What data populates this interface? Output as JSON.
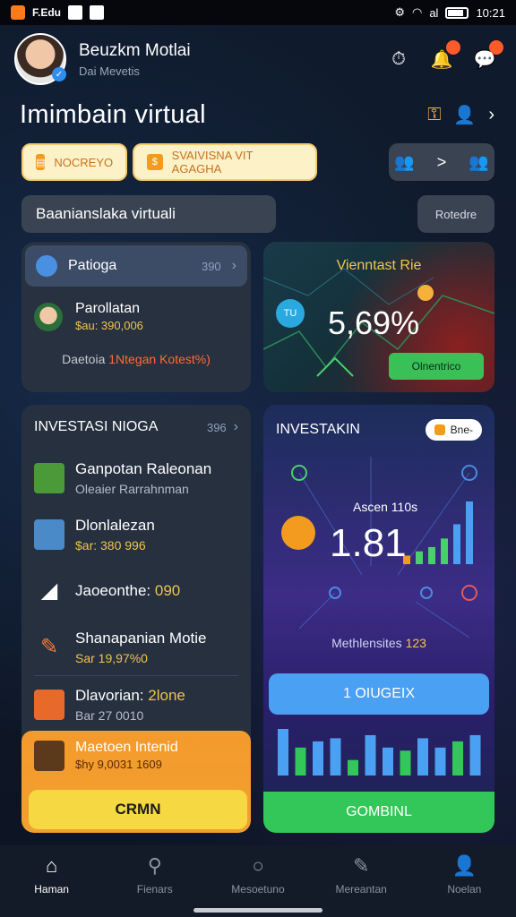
{
  "status_bar": {
    "left_text": "F.Edu",
    "time": "10:21",
    "signal_text": "al"
  },
  "header": {
    "user_name": "Beuzkm Motlai",
    "user_subtitle": "Dai Mevetis"
  },
  "title": {
    "text": "Imimbain virtual"
  },
  "chips": {
    "chip1": "NOCREYO",
    "chip2": "SVAIVISNA VIT AGAGHA",
    "chip3_icons": ">"
  },
  "search": {
    "text": "Baanianslaka virtuali",
    "button": "Rotedre"
  },
  "card_lt": {
    "row_label": "Patioga",
    "row_amount": "390",
    "item_name": "Parollatan",
    "item_value": "$au: 390,006",
    "foot_text": "Daetoia ",
    "foot_highlight": "1Ntegan Kotest%)"
  },
  "card_rt": {
    "title": "Vienntast Rie",
    "badge": "TU",
    "pct": "5,69%",
    "button": "Olnentrico"
  },
  "card_lb": {
    "title": "INVESTASI NIOGA",
    "amount": "396",
    "items": [
      {
        "name": "Ganpotan Raleonan",
        "sub": "Oleaier Rarrahnman"
      },
      {
        "name": "Dlonlalezan",
        "sub": "$ar: 380 996"
      },
      {
        "name": "Jaoeonthe: ",
        "highlight": "090"
      },
      {
        "name": "Shanapanian Motie",
        "sub": "Sar 19,97%0"
      },
      {
        "name": "Dlavorian: ",
        "highlight": "2lone",
        "sub": "Bar 27 0010"
      }
    ],
    "promo_name": "Maetoen Intenid",
    "promo_sub": "$hy 9,0031 1609",
    "promo_button": "CRMN"
  },
  "card_rb": {
    "title": "INVESTAKIN",
    "chip": "Bne-",
    "label": "Ascen 110s",
    "big": "1.81",
    "sub": "Methlensites ",
    "sub_highlight": "123",
    "button": "1 OIUGEIX",
    "footer_button": "GOMBINL"
  },
  "chart_data": {
    "type": "bar",
    "series": [
      {
        "values": [
          6,
          9,
          12,
          18,
          28,
          44
        ]
      },
      {
        "values": [
          30,
          18,
          22,
          24,
          10,
          26,
          18,
          16,
          24,
          18,
          22,
          26
        ]
      }
    ]
  },
  "bottom_nav": [
    {
      "label": "Haman",
      "icon": "home-icon"
    },
    {
      "label": "Fienars",
      "icon": "search-icon"
    },
    {
      "label": "Mesoetuno",
      "icon": "magnify-icon"
    },
    {
      "label": "Mereantan",
      "icon": "edit-icon"
    },
    {
      "label": "Noelan",
      "icon": "profile-icon"
    }
  ],
  "colors": {
    "accent_yellow": "#f6c24b",
    "accent_green": "#33c75a",
    "accent_blue": "#4aa0f2",
    "accent_orange": "#f39b1f"
  }
}
